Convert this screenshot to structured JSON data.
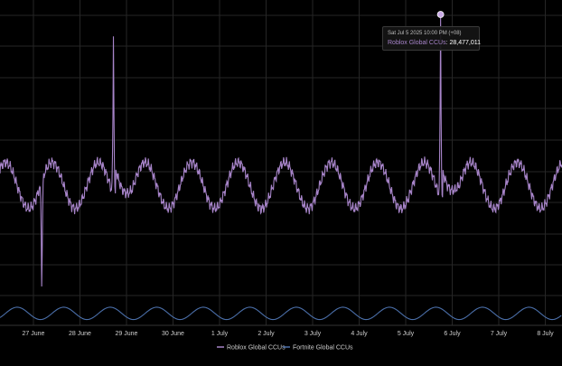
{
  "chart_data": {
    "type": "line",
    "x_ticks": [
      "27 June",
      "28 June",
      "29 June",
      "30 June",
      "1 July",
      "2 July",
      "3 July",
      "4 July",
      "5 July",
      "6 July",
      "7 July",
      "8 July"
    ],
    "grid": true,
    "legend_placement": "bottom-center",
    "series": [
      {
        "name": "Roblox Global CCUs",
        "color": "#a784c9",
        "spikes": [
          {
            "x": "27 June",
            "y_fraction": 0.06
          },
          {
            "x": "28 June",
            "y_fraction": 0.96
          },
          {
            "x": "5 July",
            "y_fraction": 1.0
          }
        ],
        "daily_peak_fraction": 0.52,
        "daily_trough_fraction": 0.37
      },
      {
        "name": "Fortnite Global CCUs",
        "color": "#4a6ea8",
        "daily_peak_fraction": 0.05,
        "daily_trough_fraction": 0.01
      }
    ],
    "tooltip": {
      "date": "Sat Jul 5 2025 10:00 PM (+08)",
      "series": "Roblox Global CCUs",
      "value": "28,477,011"
    }
  }
}
